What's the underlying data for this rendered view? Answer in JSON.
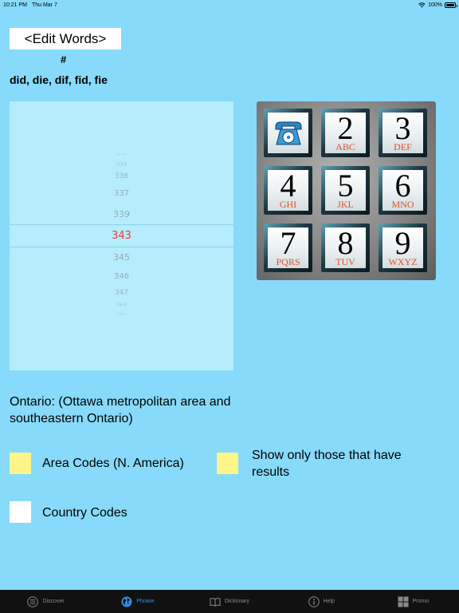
{
  "status": {
    "time": "10:21 PM",
    "date": "Thu Mar 7",
    "battery": "100%",
    "battery_level": 1.0
  },
  "header": {
    "edit_words_label": "<Edit Words>",
    "hash": "#",
    "words": "did, die, dif, fid, fie"
  },
  "picker": {
    "items": [
      "333",
      "334",
      "336",
      "337",
      "339",
      "343",
      "345",
      "346",
      "347",
      "364",
      "365"
    ],
    "selected_index": 5
  },
  "keypad": {
    "keys": [
      {
        "num": "",
        "letters": "",
        "icon": "telephone-icon"
      },
      {
        "num": "2",
        "letters": "ABC"
      },
      {
        "num": "3",
        "letters": "DEF"
      },
      {
        "num": "4",
        "letters": "GHI"
      },
      {
        "num": "5",
        "letters": "JKL"
      },
      {
        "num": "6",
        "letters": "MNO"
      },
      {
        "num": "7",
        "letters": "PQRS"
      },
      {
        "num": "8",
        "letters": "TUV"
      },
      {
        "num": "9",
        "letters": "WXYZ"
      }
    ]
  },
  "region": {
    "text": "Ontario: (Ottawa metropolitan area and southeastern Ontario)"
  },
  "options": {
    "area_codes": {
      "label": "Area Codes (N. America)",
      "color": "#fdf58a"
    },
    "show_only": {
      "label": "Show only those that have results",
      "color": "#fdf58a"
    },
    "country_codes": {
      "label": "Country Codes",
      "color": "#ffffff"
    }
  },
  "tabs": [
    {
      "label": "Discover",
      "icon": "keypad-grid-icon",
      "active": false
    },
    {
      "label": "Phrase",
      "icon": "globe-icon",
      "active": true
    },
    {
      "label": "Dictionary",
      "icon": "book-icon",
      "active": false
    },
    {
      "label": "Help",
      "icon": "info-icon",
      "active": false
    },
    {
      "label": "Promo",
      "icon": "tiles-icon",
      "active": false
    }
  ],
  "colors": {
    "background": "#87dafa",
    "picker": "#b5edfc",
    "selected_value": "#e23d3d",
    "tab_active": "#2f8fe8",
    "key_letters": "#e0502a"
  }
}
